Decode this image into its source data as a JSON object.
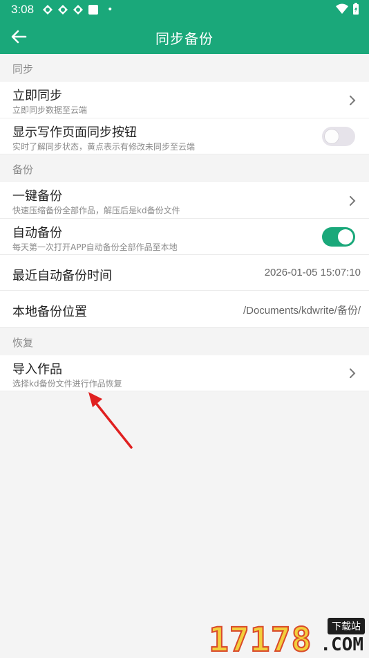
{
  "status_bar": {
    "time": "3:08",
    "icons": [
      "notification-app-icon",
      "notification-app-icon",
      "notification-app-icon",
      "notification-square-icon"
    ],
    "dot": "•",
    "right_icons": [
      "wifi-icon",
      "battery-icon"
    ]
  },
  "app_bar": {
    "title": "同步备份",
    "back_icon": "arrow-left-icon"
  },
  "sections": {
    "sync": {
      "header": "同步",
      "immediate": {
        "title": "立即同步",
        "subtitle": "立即同步数据至云端"
      },
      "show_button": {
        "title": "显示写作页面同步按钮",
        "subtitle": "实时了解同步状态，黄点表示有修改未同步至云端",
        "enabled": false
      }
    },
    "backup": {
      "header": "备份",
      "one_click": {
        "title": "一键备份",
        "subtitle": "快速压缩备份全部作品，解压后是kd备份文件"
      },
      "auto": {
        "title": "自动备份",
        "subtitle": "每天第一次打开APP自动备份全部作品至本地",
        "enabled": true
      },
      "last_time": {
        "title": "最近自动备份时间",
        "value": "2026-01-05 15:07:10"
      },
      "location": {
        "title": "本地备份位置",
        "value": "/Documents/kdwrite/备份/"
      }
    },
    "restore": {
      "header": "恢复",
      "import": {
        "title": "导入作品",
        "subtitle": "选择kd备份文件进行作品恢复"
      }
    }
  },
  "watermark": {
    "number": "17178",
    "tag": "下载站",
    "suffix": ".COM"
  },
  "colors": {
    "primary": "#1aa87a",
    "annotation_arrow": "#e02020"
  }
}
